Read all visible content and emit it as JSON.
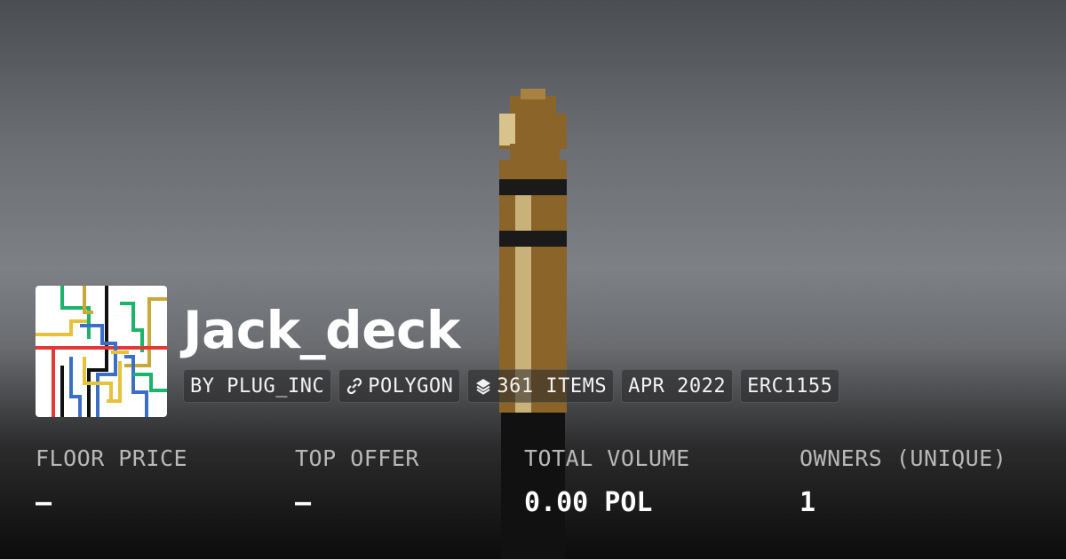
{
  "collection": {
    "name": "Jack_deck",
    "badges": [
      {
        "label": "BY PLUG_INC",
        "icon": ""
      },
      {
        "label": "POLYGON",
        "icon": "link-icon"
      },
      {
        "label": "361 ITEMS",
        "icon": "layers-icon"
      },
      {
        "label": "APR 2022",
        "icon": ""
      },
      {
        "label": "ERC1155",
        "icon": ""
      }
    ]
  },
  "stats": [
    {
      "label": "FLOOR PRICE",
      "value": "–"
    },
    {
      "label": "TOP OFFER",
      "value": "–"
    },
    {
      "label": "TOTAL VOLUME",
      "value": "0.00 POL"
    },
    {
      "label": "OWNERS (UNIQUE)",
      "value": "1"
    }
  ],
  "colors": {
    "jack_gold": "#8a6428",
    "jack_light": "#c9b27a",
    "jack_band": "#1a1a1a"
  }
}
